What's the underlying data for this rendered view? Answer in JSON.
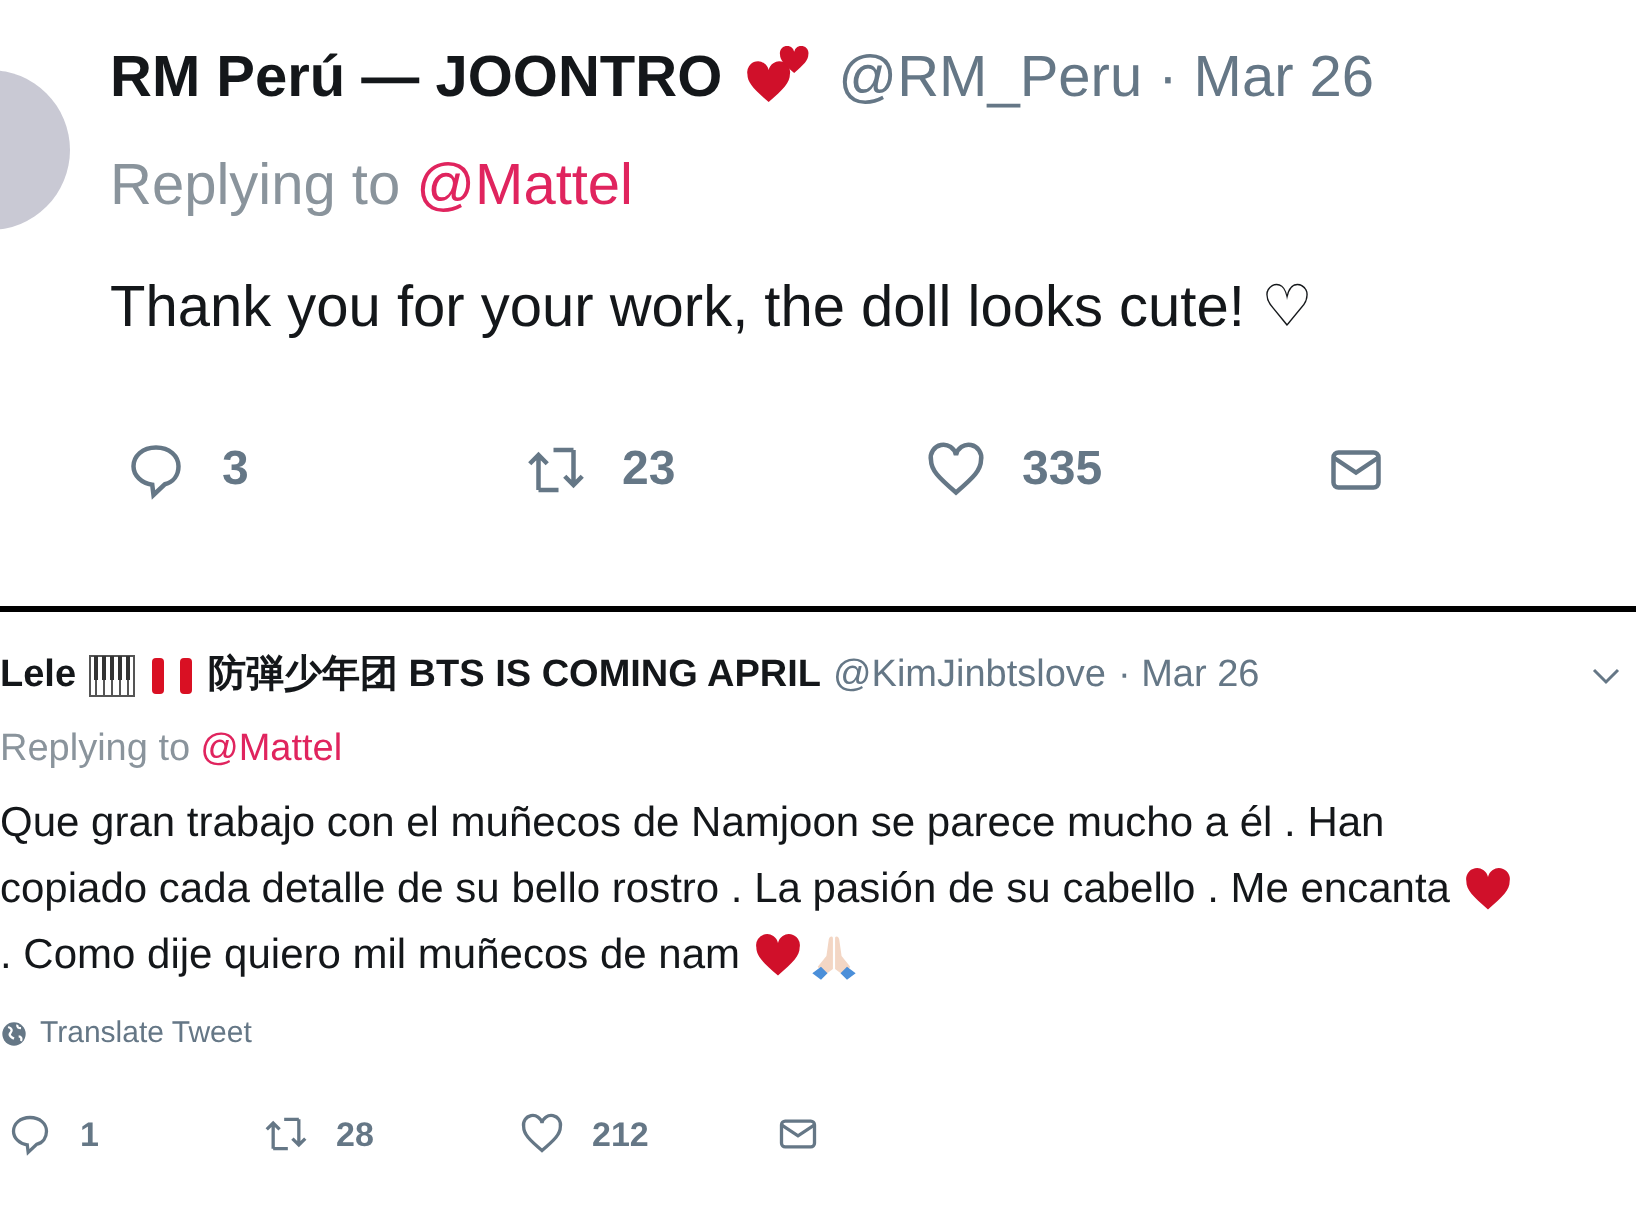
{
  "tweets": [
    {
      "name": "RM Perú — JOONTRO",
      "handle": "@RM_Peru",
      "time": "· Mar 26",
      "replying_label": "Replying to",
      "replying_to": "@Mattel",
      "body": [
        "Thank you for your work, the doll looks cute! ♡"
      ],
      "actions": {
        "replies": "3",
        "retweets": "23",
        "likes": "335"
      }
    },
    {
      "name": "Lele",
      "name_rest": "防弾少年团 BTS IS COMING APRIL",
      "handle": "@KimJinbtslove",
      "time": "· Mar 26",
      "replying_label": "Replying to",
      "replying_to": "@Mattel",
      "body": [
        "Que gran trabajo con el muñecos de Namjoon se parece mucho a él . Han",
        "copiado cada detalle de su bello rostro . La pasión de su cabello . Me encanta",
        ". Como dije quiero mil muñecos de nam"
      ],
      "translate": "Translate Tweet",
      "actions": {
        "replies": "1",
        "retweets": "28",
        "likes": "212"
      }
    }
  ]
}
